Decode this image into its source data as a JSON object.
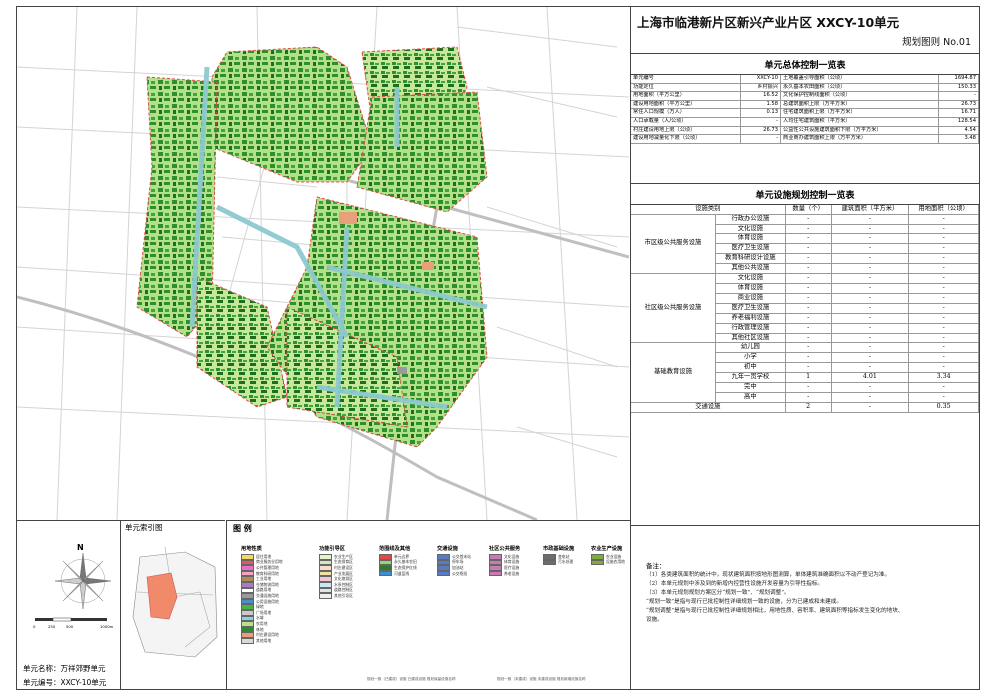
{
  "title": {
    "main": "上海市临港新片区新兴产业片区 XXCY-10单元",
    "sub": "规划图则 No.01"
  },
  "control_table": {
    "title": "单元总体控制一览表",
    "rows": [
      {
        "label": "单元编号",
        "value": "XXCY-10",
        "label2": "土地覆盖引导面积（公顷）",
        "value2": "1694.87"
      },
      {
        "label": "功能定位",
        "value": "乡村振兴",
        "label2": "永久基本农田面积（公顷）",
        "value2": "150.33"
      },
      {
        "label": "用地面积（平方公里）",
        "value": "16.52",
        "label2": "文化保护控制线面积（公顷）",
        "value2": "-"
      },
      {
        "label": "建设用地面积（平方公里）",
        "value": "1.58",
        "label2": "总建筑面积上限（万平方米）",
        "value2": "26.73"
      },
      {
        "label": "常住人口规模（万人）",
        "value": "0.13",
        "label2": "住宅建筑面积上限（万平方米）",
        "value2": "16.71"
      },
      {
        "label": "人口承载量（人/公顷）",
        "value": "-",
        "label2": "人均住宅建筑面积（平方米）",
        "value2": "128.54"
      },
      {
        "label": "村庄建设用地上限（公顷）",
        "value": "26.73",
        "label2": "公益性公共设施建筑面积下限（万平方米）",
        "value2": "4.54"
      },
      {
        "label": "建设用地减量化下限（公顷）",
        "value": "-",
        "label2": "商业商办建筑面积上限（万平方米）",
        "value2": "3.48"
      }
    ]
  },
  "facility_table": {
    "title": "单元设施规划控制一览表",
    "headers": [
      "设施类别",
      "数量（个）",
      "建筑面积（平方米）",
      "用地面积（公顷）"
    ],
    "groups": [
      {
        "category": "市区级公共服务设施",
        "items": [
          {
            "name": "行政办公设施",
            "count": "-",
            "area": "-",
            "land": "-"
          },
          {
            "name": "文化设施",
            "count": "-",
            "area": "-",
            "land": "-"
          },
          {
            "name": "体育设施",
            "count": "-",
            "area": "-",
            "land": "-"
          },
          {
            "name": "医疗卫生设施",
            "count": "-",
            "area": "-",
            "land": "-"
          },
          {
            "name": "教育科研设计设施",
            "count": "-",
            "area": "-",
            "land": "-"
          },
          {
            "name": "其他公共设施",
            "count": "-",
            "area": "-",
            "land": "-"
          }
        ]
      },
      {
        "category": "社区级公共服务设施",
        "items": [
          {
            "name": "文化设施",
            "count": "-",
            "area": "-",
            "land": "-"
          },
          {
            "name": "体育设施",
            "count": "-",
            "area": "-",
            "land": "-"
          },
          {
            "name": "商业设施",
            "count": "-",
            "area": "-",
            "land": "-"
          },
          {
            "name": "医疗卫生设施",
            "count": "-",
            "area": "-",
            "land": "-"
          },
          {
            "name": "养老福利设施",
            "count": "-",
            "area": "-",
            "land": "-"
          },
          {
            "name": "行政管理设施",
            "count": "-",
            "area": "-",
            "land": "-"
          },
          {
            "name": "其他社区设施",
            "count": "-",
            "area": "-",
            "land": "-"
          }
        ]
      },
      {
        "category": "基础教育设施",
        "items": [
          {
            "name": "幼儿园",
            "count": "-",
            "area": "-",
            "land": "-"
          },
          {
            "name": "小学",
            "count": "-",
            "area": "-",
            "land": "-"
          },
          {
            "name": "初中",
            "count": "-",
            "area": "-",
            "land": "-"
          },
          {
            "name": "九年一贯学校",
            "count": "1",
            "area": "4.01",
            "land": "3.34"
          },
          {
            "name": "完中",
            "count": "-",
            "area": "-",
            "land": "-"
          },
          {
            "name": "高中",
            "count": "-",
            "area": "-",
            "land": "-"
          }
        ]
      }
    ],
    "traffic": {
      "name": "交通设施",
      "count": "2",
      "area": "-",
      "land": "0.35"
    }
  },
  "notes": {
    "title": "备注：",
    "lines": [
      "（1）各类建筑面积的统计中，现状建筑面积按地形图测算，单体建筑准确面积以不动产登记为准。",
      "（2）本单元规划中涉及到的新增内控营性设施开发容量为引导性指标。",
      "（3）本单元规划规划方案区分“规划一致”、“规划调整”。",
      "“规划一致”是指与现行已批控制性详细规划一致的设施，分为已建成和未建成。",
      "“规划调整”是指与现行已批控制性详细规划相比，用地性质、容积率、建筑面积等指标发生变化的地块、",
      "设施。"
    ]
  },
  "bottom_left": {
    "north": "N",
    "scale_labels": [
      "0",
      "250",
      "500",
      "1000m"
    ],
    "unit_name": "单元名称：万祥郊野单元",
    "unit_code": "单元编号：XXCY-10单元"
  },
  "index_map": {
    "title": "单元索引图"
  },
  "legend": {
    "title": "图 例",
    "groups": [
      {
        "head": "用地性质",
        "items": [
          {
            "label": "居住用地",
            "color": "#f2d76b"
          },
          {
            "label": "商业服务业用地",
            "color": "#e8585a"
          },
          {
            "label": "公共管理用地",
            "color": "#e96fc0"
          },
          {
            "label": "教育科研用地",
            "color": "#f4a3c3"
          },
          {
            "label": "工业用地",
            "color": "#b58a5a"
          },
          {
            "label": "仓储物流用地",
            "color": "#a67dbf"
          },
          {
            "label": "道路用地",
            "color": "#ffffff"
          },
          {
            "label": "交通设施用地",
            "color": "#9a9a9a"
          },
          {
            "label": "公用设施用地",
            "color": "#4b8ec9"
          },
          {
            "label": "绿地",
            "color": "#47b443"
          },
          {
            "label": "广场用地",
            "color": "#c9c9c9"
          },
          {
            "label": "水域",
            "color": "#8fd0e8"
          },
          {
            "label": "农用地",
            "color": "#b9e08a"
          },
          {
            "label": "林地",
            "color": "#2e8a2e"
          },
          {
            "label": "村庄建设用地",
            "color": "#e8a07a"
          },
          {
            "label": "其他用地",
            "color": "#d9d9d9"
          }
        ]
      },
      {
        "head": "功能引导区",
        "items": [
          {
            "label": "农业生产区",
            "color": "#e7f3cf"
          },
          {
            "label": "生态保育区",
            "color": "#cfe8c0"
          },
          {
            "label": "村庄建设区",
            "color": "#f5dcc6"
          },
          {
            "label": "产业发展区",
            "color": "#f0e1a8"
          },
          {
            "label": "文化旅游区",
            "color": "#f0c6d8"
          },
          {
            "label": "水系控制区",
            "color": "#cde7f2"
          },
          {
            "label": "道路控制区",
            "color": "#e3e3e3"
          },
          {
            "label": "其他引导区",
            "color": "#efefef"
          }
        ]
      },
      {
        "head": "范围线及其他",
        "items": [
          {
            "label": "单元边界",
            "color": "#e24848"
          },
          {
            "label": "永久基本农田",
            "color": "#9fd07a"
          },
          {
            "label": "生态保护红线",
            "color": "#2d7a2d"
          },
          {
            "label": "河道蓝线",
            "color": "#3c8fd0"
          }
        ]
      },
      {
        "head": "交通设施",
        "items": [
          {
            "label": "公交首末站",
            "color": "#5a7bc2"
          },
          {
            "label": "停车场",
            "color": "#5a7bc2"
          },
          {
            "label": "加油站",
            "color": "#5a7bc2"
          },
          {
            "label": "公交枢纽",
            "color": "#5a7bc2"
          }
        ]
      },
      {
        "head": "社区公共服务",
        "items": [
          {
            "label": "文化设施",
            "color": "#c97ab4"
          },
          {
            "label": "体育设施",
            "color": "#c97ab4"
          },
          {
            "label": "医疗设施",
            "color": "#c97ab4"
          },
          {
            "label": "养老设施",
            "color": "#c97ab4"
          }
        ]
      },
      {
        "head": "市政基础设施",
        "items": [
          {
            "label": "变电站",
            "color": "#6c6c6c"
          },
          {
            "label": "污水处理",
            "color": "#6c6c6c"
          }
        ]
      },
      {
        "head": "农业生产设施",
        "items": [
          {
            "label": "农业设施",
            "color": "#7dab3d"
          },
          {
            "label": "设施农用地",
            "color": "#7dab3d"
          }
        ]
      }
    ],
    "footnotes": [
      "规划一致（已建成）设施  已建成设施 规划保留设施名称",
      "规划一致（未建成）设施  未建成设施 规划新增设施名称"
    ]
  },
  "colors": {
    "built": "#3aa83a",
    "built_dark": "#1f6e1f",
    "water": "#8dc9cf",
    "boundary": "#e24848",
    "road": "#bfbfbf",
    "field": "#b9e38a"
  }
}
